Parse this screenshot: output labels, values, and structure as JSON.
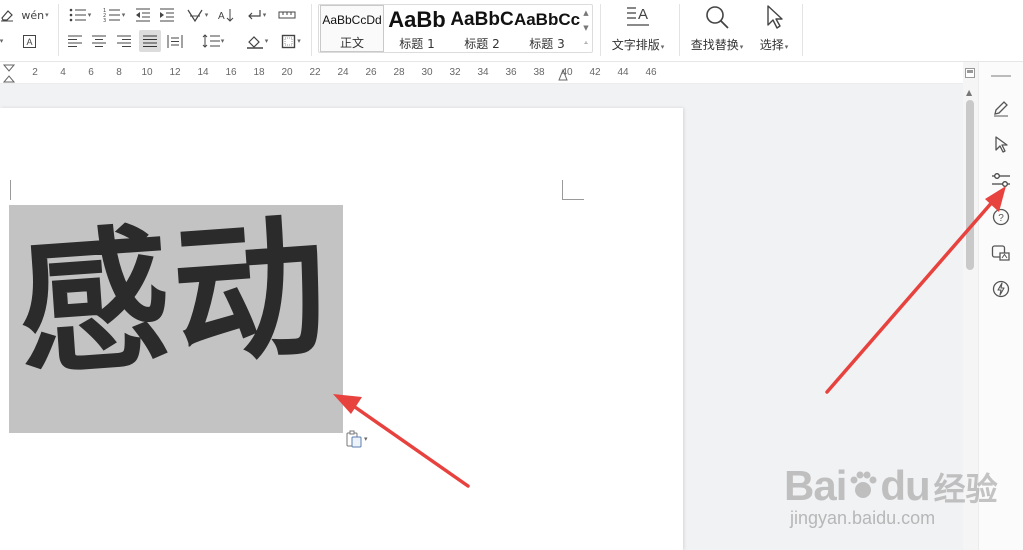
{
  "ribbon": {
    "pinyin_label": "wén",
    "styles": [
      {
        "sample": "AaBbCcDd",
        "name": "正文"
      },
      {
        "sample": "AaBb",
        "name": "标题 1"
      },
      {
        "sample": "AaBbC",
        "name": "标题 2"
      },
      {
        "sample": "AaBbCc",
        "name": "标题 3"
      }
    ],
    "text_layout_label": "文字排版",
    "find_replace_label": "查找替换",
    "select_label": "选择"
  },
  "ruler": {
    "ticks": [
      "2",
      "4",
      "6",
      "8",
      "10",
      "12",
      "14",
      "16",
      "18",
      "20",
      "22",
      "24",
      "26",
      "28",
      "30",
      "32",
      "34",
      "36",
      "38",
      "40",
      "42",
      "44",
      "46"
    ]
  },
  "document": {
    "image_text": "感动"
  },
  "side_panel": {
    "items": [
      "pen-icon",
      "select-icon",
      "settings-icon",
      "help-icon",
      "translate-icon",
      "ai-icon"
    ]
  },
  "watermark": {
    "brand": "Bai",
    "brand2": "du",
    "cn": "经验",
    "url": "jingyan.baidu.com"
  },
  "colors": {
    "accent_arrow": "#e8423f",
    "image_bg": "#c3c3c3"
  }
}
